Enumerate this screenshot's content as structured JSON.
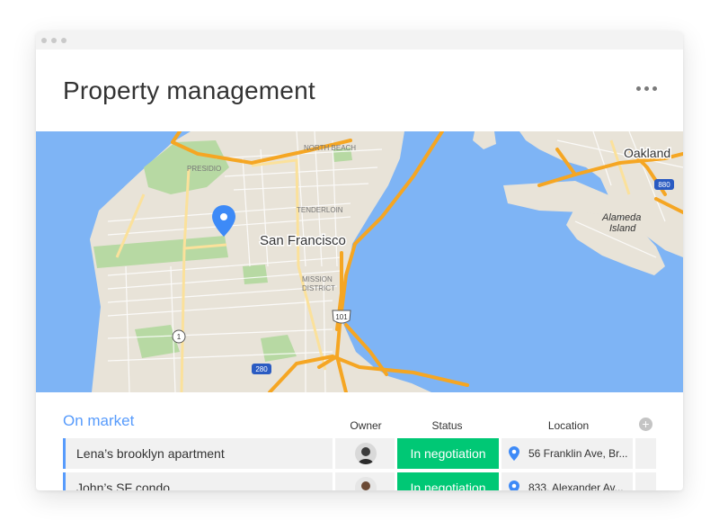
{
  "app": {
    "title": "Property management",
    "more_icon": "more-horizontal-icon"
  },
  "map": {
    "labels": {
      "city_main": "San Francisco",
      "city_oakland": "Oakland",
      "island": "Alameda Island",
      "island_line1": "Alameda",
      "island_line2": "Island",
      "north_beach": "NORTH BEACH",
      "presidio": "PRESIDIO",
      "tenderloin": "TENDERLOIN",
      "mission_line1": "MISSION",
      "mission_line2": "DISTRICT"
    },
    "shields": {
      "us101": "101",
      "i280": "280",
      "hwy1": "1",
      "i880": "880"
    },
    "colors": {
      "water": "#7eb4f5",
      "land": "#e8e3d8",
      "park": "#b7d9a3",
      "highway": "#f5a623",
      "arterial": "#fbe19b",
      "pin": "#3d8af7"
    }
  },
  "board": {
    "group_title": "On market",
    "columns": {
      "owner": "Owner",
      "status": "Status",
      "location": "Location"
    },
    "add_column_icon": "plus-circle-icon",
    "rows": [
      {
        "name": "Lena’s brooklyn apartment",
        "status": "In negotiation",
        "location": "56 Franklin Ave, Br...",
        "status_color": "#00c875"
      },
      {
        "name": "John’s SF condo",
        "status": "In negotiation",
        "location": "833, Alexander Av...",
        "status_color": "#00c875"
      }
    ]
  }
}
